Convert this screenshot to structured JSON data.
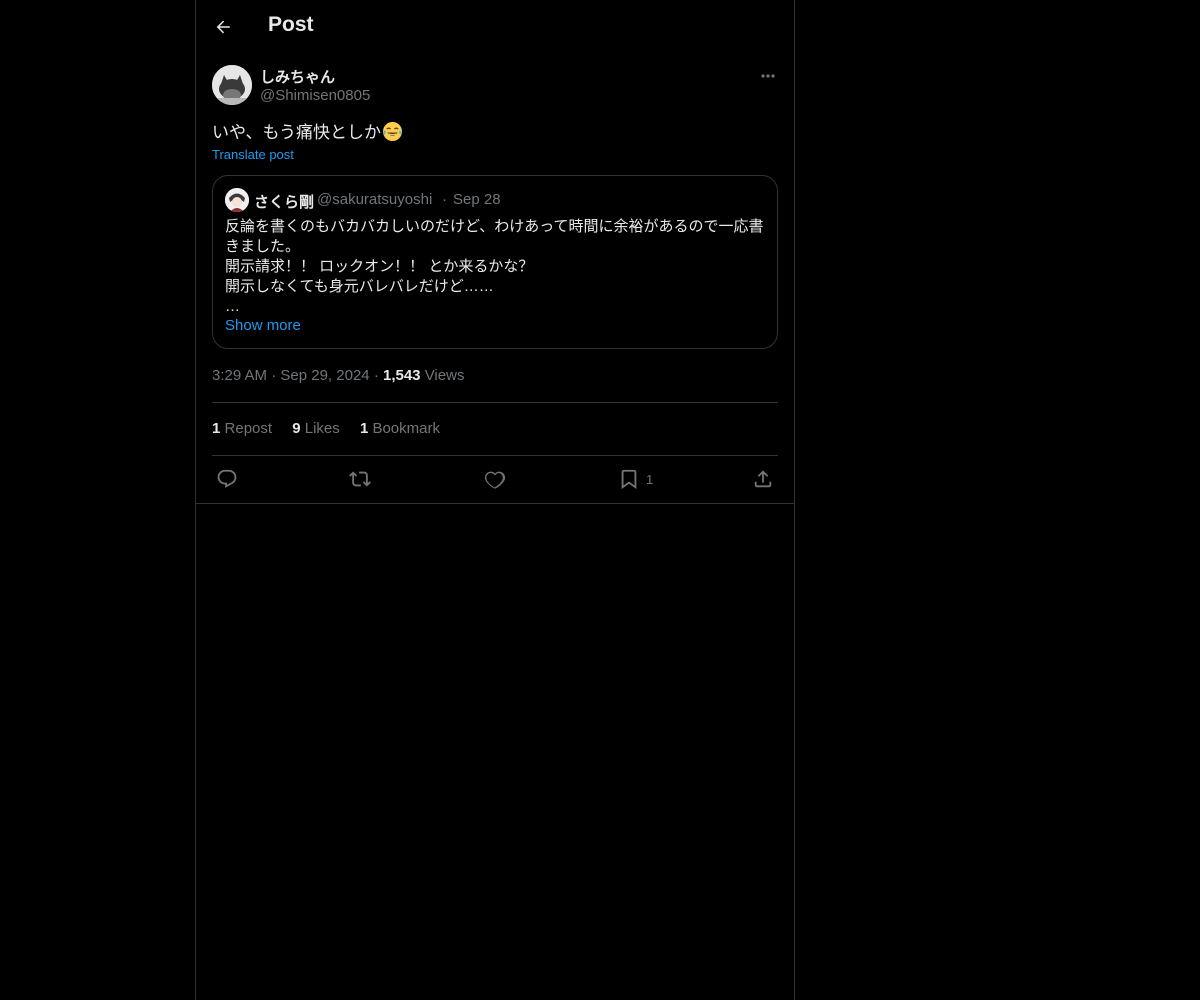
{
  "header": {
    "title": "Post",
    "back_icon": "arrow-left-icon"
  },
  "post": {
    "display_name": "しみちゃん",
    "handle": "@Shimisen0805",
    "text": "いや、もう痛快としか",
    "emoji": "face-with-tears-of-joy",
    "translate_label": "Translate post",
    "time": "3:29 AM",
    "date": "Sep 29, 2024",
    "views_count": "1,543",
    "views_label": "Views"
  },
  "quote": {
    "display_name": "さくら剛",
    "handle": "@sakuratsuyoshi",
    "date": "Sep 28",
    "lines": [
      "反論を書くのもバカバカしいのだけど、わけあって時間に余裕があるので一応書",
      "きました。",
      "開示請求！！ ロックオン！！ とか来るかな？",
      "開示しなくても身元バレバレだけど……",
      "…"
    ],
    "show_more": "Show more"
  },
  "stats": {
    "reposts_count": "1",
    "reposts_label": "Repost",
    "likes_count": "9",
    "likes_label": "Likes",
    "bookmarks_count": "1",
    "bookmarks_label": "Bookmark"
  },
  "actions": {
    "bookmark_count": "1"
  },
  "colors": {
    "background": "#000000",
    "border": "#2f3336",
    "text_primary": "#e7e9ea",
    "text_secondary": "#71767b",
    "link": "#1d9bf0"
  }
}
